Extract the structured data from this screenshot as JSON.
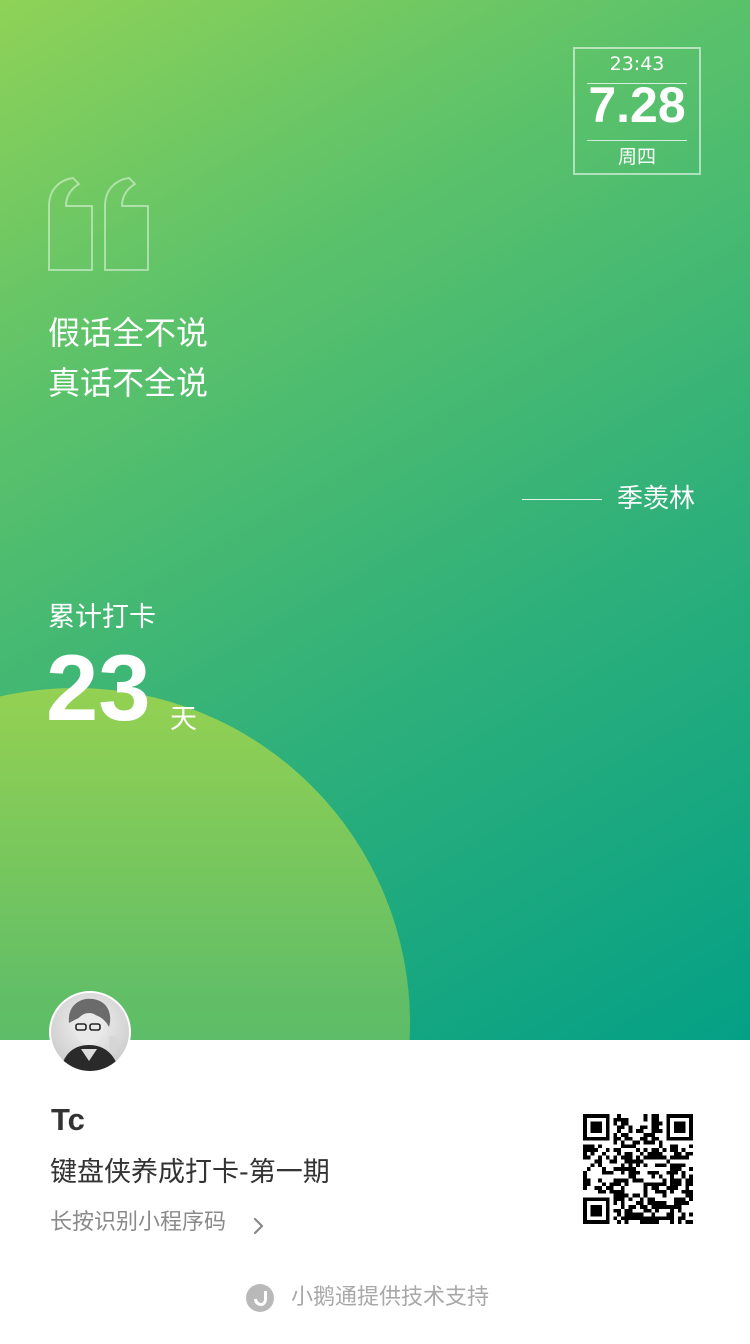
{
  "datebox": {
    "time": "23:43",
    "date": "7.28",
    "weekday": "周四"
  },
  "quote": {
    "lines": [
      "假话全不说",
      "真话不全说"
    ],
    "author": "季羡林"
  },
  "checkin": {
    "label": "累计打卡",
    "count": "23",
    "unit": "天"
  },
  "user": {
    "name": "Tc",
    "program": "键盘侠养成打卡-第一期",
    "hint": "长按识别小程序码"
  },
  "footer": {
    "text": "小鹅通提供技术支持"
  },
  "icons": {
    "quote": "quote-mark-icon",
    "chevron": "chevron-right-icon",
    "footer_logo": "xiaoetong-logo-icon"
  },
  "colors": {
    "gradient_start": "#8fd257",
    "gradient_end": "#04a086",
    "text_dark": "#333333",
    "text_gray": "#8a8a8a"
  }
}
